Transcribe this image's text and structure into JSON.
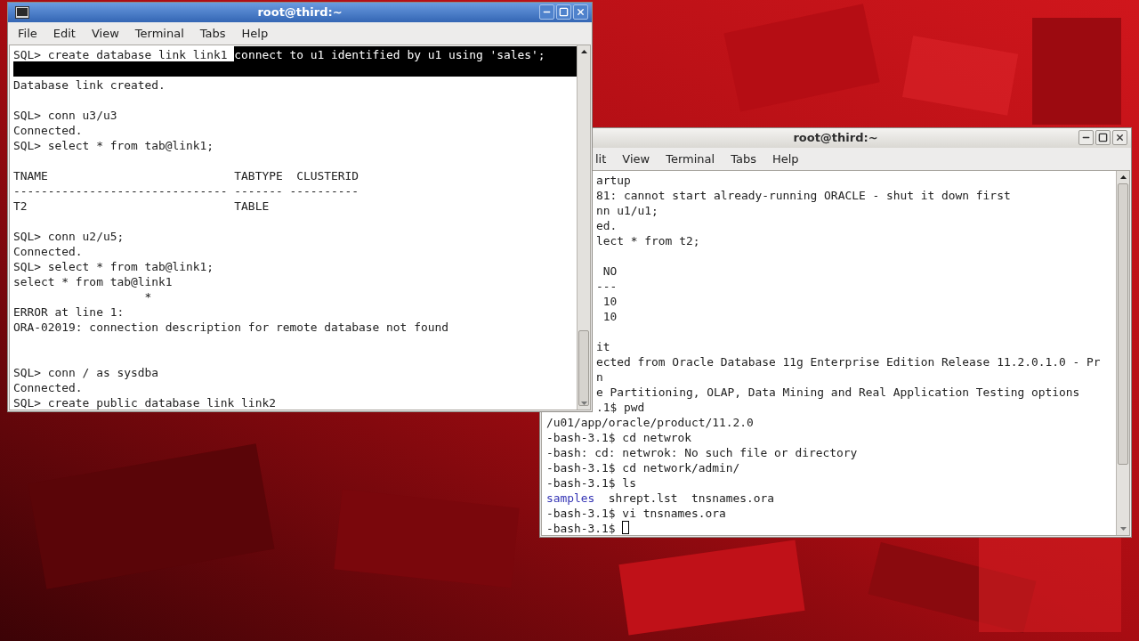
{
  "windows": [
    {
      "title": "root@third:~",
      "active": false,
      "menu": [
        "lit",
        "View",
        "Terminal",
        "Tabs",
        "Help"
      ],
      "covered_lines": [
        {
          "kind": "text",
          "segments": [
            {
              "text": "artup"
            }
          ]
        },
        {
          "kind": "text",
          "segments": [
            {
              "text": "81: cannot start already-running ORACLE - shut it down first"
            }
          ]
        },
        {
          "kind": "text",
          "segments": [
            {
              "text": "nn u1/u1;"
            }
          ]
        },
        {
          "kind": "text",
          "segments": [
            {
              "text": "ed."
            }
          ]
        },
        {
          "kind": "text",
          "segments": [
            {
              "text": "lect * from t2;"
            }
          ]
        },
        {
          "kind": "blank"
        },
        {
          "kind": "text",
          "segments": [
            {
              "text": " NO"
            }
          ]
        },
        {
          "kind": "text",
          "segments": [
            {
              "text": "---"
            }
          ]
        },
        {
          "kind": "text",
          "segments": [
            {
              "text": " 10"
            }
          ]
        },
        {
          "kind": "text",
          "segments": [
            {
              "text": " 10"
            }
          ]
        },
        {
          "kind": "blank"
        },
        {
          "kind": "text",
          "segments": [
            {
              "text": "it"
            }
          ]
        },
        {
          "kind": "text",
          "segments": [
            {
              "text": "ected from Oracle Database 11g Enterprise Edition Release 11.2.0.1.0 - Pr"
            }
          ]
        },
        {
          "kind": "text",
          "segments": [
            {
              "text": "n"
            }
          ]
        },
        {
          "kind": "text",
          "segments": [
            {
              "text": "e Partitioning, OLAP, Data Mining and Real Application Testing options"
            }
          ]
        },
        {
          "kind": "text",
          "segments": [
            {
              "text": ".1$ pwd"
            }
          ]
        }
      ],
      "lines": [
        {
          "kind": "text",
          "segments": [
            {
              "text": "/u01/app/oracle/product/11.2.0"
            }
          ]
        },
        {
          "kind": "text",
          "segments": [
            {
              "text": "-bash-3.1$ cd netwrok"
            }
          ]
        },
        {
          "kind": "text",
          "segments": [
            {
              "text": "-bash: cd: netwrok: No such file or directory"
            }
          ]
        },
        {
          "kind": "text",
          "segments": [
            {
              "text": "-bash-3.1$ cd network/admin/"
            }
          ]
        },
        {
          "kind": "text",
          "segments": [
            {
              "text": "-bash-3.1$ ls"
            }
          ]
        },
        {
          "kind": "text",
          "segments": [
            {
              "text": "samples",
              "color": "#3535b5"
            },
            {
              "text": "  shrept.lst  tnsnames.ora"
            }
          ]
        },
        {
          "kind": "text",
          "segments": [
            {
              "text": "-bash-3.1$ vi tnsnames.ora"
            }
          ]
        },
        {
          "kind": "text",
          "cursor": true,
          "segments": [
            {
              "text": "-bash-3.1$ "
            }
          ]
        }
      ]
    },
    {
      "title": "root@third:~",
      "active": true,
      "menu": [
        "File",
        "Edit",
        "View",
        "Terminal",
        "Tabs",
        "Help"
      ],
      "lines": [
        {
          "kind": "text",
          "segments": [
            {
              "text": "SQL> create database link link1 ",
              "selected": false
            },
            {
              "text": "connect to u1 identified by u1 using 'sales';",
              "selected": true
            }
          ]
        },
        {
          "kind": "selection"
        },
        {
          "kind": "text",
          "segments": [
            {
              "text": "Database link created.",
              "selected": false
            }
          ]
        },
        {
          "kind": "blank"
        },
        {
          "kind": "text",
          "segments": [
            {
              "text": "SQL> conn u3/u3",
              "selected": false
            }
          ]
        },
        {
          "kind": "text",
          "segments": [
            {
              "text": "Connected.",
              "selected": false
            }
          ]
        },
        {
          "kind": "text",
          "segments": [
            {
              "text": "SQL> select * from tab@link1;",
              "selected": false
            }
          ]
        },
        {
          "kind": "blank"
        },
        {
          "kind": "text",
          "segments": [
            {
              "text": "TNAME                           TABTYPE  CLUSTERID",
              "selected": false
            }
          ]
        },
        {
          "kind": "text",
          "segments": [
            {
              "text": "------------------------------- ------- ----------",
              "selected": false
            }
          ]
        },
        {
          "kind": "text",
          "segments": [
            {
              "text": "T2                              TABLE",
              "selected": false
            }
          ]
        },
        {
          "kind": "blank"
        },
        {
          "kind": "text",
          "segments": [
            {
              "text": "SQL> conn u2/u5;",
              "selected": false
            }
          ]
        },
        {
          "kind": "text",
          "segments": [
            {
              "text": "Connected.",
              "selected": false
            }
          ]
        },
        {
          "kind": "text",
          "segments": [
            {
              "text": "SQL> select * from tab@link1;",
              "selected": false
            }
          ]
        },
        {
          "kind": "text",
          "segments": [
            {
              "text": "select * from tab@link1",
              "selected": false
            }
          ]
        },
        {
          "kind": "text",
          "segments": [
            {
              "text": "                   *",
              "selected": false
            }
          ]
        },
        {
          "kind": "text",
          "segments": [
            {
              "text": "ERROR at line 1:",
              "selected": false
            }
          ]
        },
        {
          "kind": "text",
          "segments": [
            {
              "text": "ORA-02019: connection description for remote database not found",
              "selected": false
            }
          ]
        },
        {
          "kind": "blank"
        },
        {
          "kind": "blank"
        },
        {
          "kind": "text",
          "segments": [
            {
              "text": "SQL> conn / as sysdba",
              "selected": false
            }
          ]
        },
        {
          "kind": "text",
          "segments": [
            {
              "text": "Connected.",
              "selected": false
            }
          ]
        },
        {
          "kind": "text",
          "segments": [
            {
              "text": "SQL> create public database link link2",
              "selected": false
            }
          ]
        }
      ]
    }
  ]
}
